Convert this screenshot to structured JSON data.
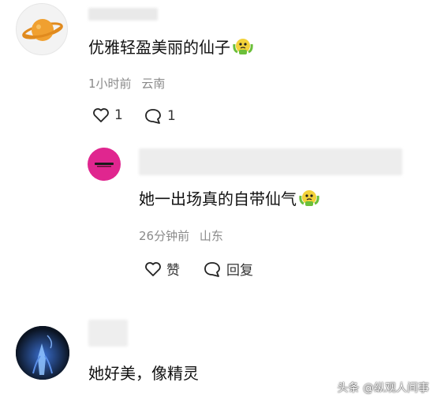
{
  "comments": [
    {
      "text": "优雅轻盈美丽的仙子",
      "time": "1小时前",
      "location": "云南",
      "like_count": "1",
      "reply_count": "1",
      "emoji_icon": "crying-face-emoji"
    },
    {
      "text": "她一出场真的自带仙气",
      "time": "26分钟前",
      "location": "山东",
      "like_label": "赞",
      "reply_label": "回复",
      "emoji_icon": "crying-face-emoji"
    },
    {
      "text": "她好美，像精灵"
    }
  ],
  "watermark": "头条 @纵观人间事",
  "colors": {
    "avatar1_bg": "#f3f3f3",
    "avatar2_bg": "#e0268f",
    "avatar3_bg": "#0b1422",
    "meta_text": "#8a8a8a"
  }
}
